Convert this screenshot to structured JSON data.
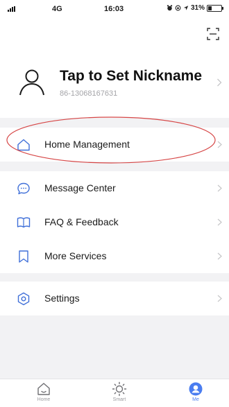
{
  "status_bar": {
    "network": "4G",
    "time": "16:03",
    "battery_text": "31%",
    "battery_level": 0.31,
    "icons": [
      "signal-icon",
      "alarm-icon",
      "orientation-lock-icon",
      "location-arrow-icon",
      "battery-icon"
    ]
  },
  "profile": {
    "nickname": "Tap to Set Nickname",
    "account_id": "86-13068167631",
    "avatar_icon": "user-avatar-icon",
    "scan_icon": "scan-icon"
  },
  "menu": {
    "home_management": {
      "label": "Home Management",
      "icon": "home-icon"
    },
    "message_center": {
      "label": "Message Center",
      "icon": "chat-bubble-icon"
    },
    "faq_feedback": {
      "label": "FAQ & Feedback",
      "icon": "book-icon"
    },
    "more_services": {
      "label": "More Services",
      "icon": "bookmark-icon"
    },
    "settings": {
      "label": "Settings",
      "icon": "hexagon-settings-icon"
    }
  },
  "annotation": {
    "color": "#d64545",
    "shape": "ellipse-around-home-management"
  },
  "bottom_nav": {
    "active_tab": "Me",
    "items": [
      {
        "label": "Home",
        "icon": "home-tab-icon"
      },
      {
        "label": "Smart",
        "icon": "sun-icon"
      },
      {
        "label": "Me",
        "icon": "person-filled-icon"
      }
    ]
  },
  "colors": {
    "accent": "#4a7df0",
    "icon_blue": "#3f6fd8",
    "background": "#f2f2f4",
    "chevron": "#c6c6c8"
  }
}
